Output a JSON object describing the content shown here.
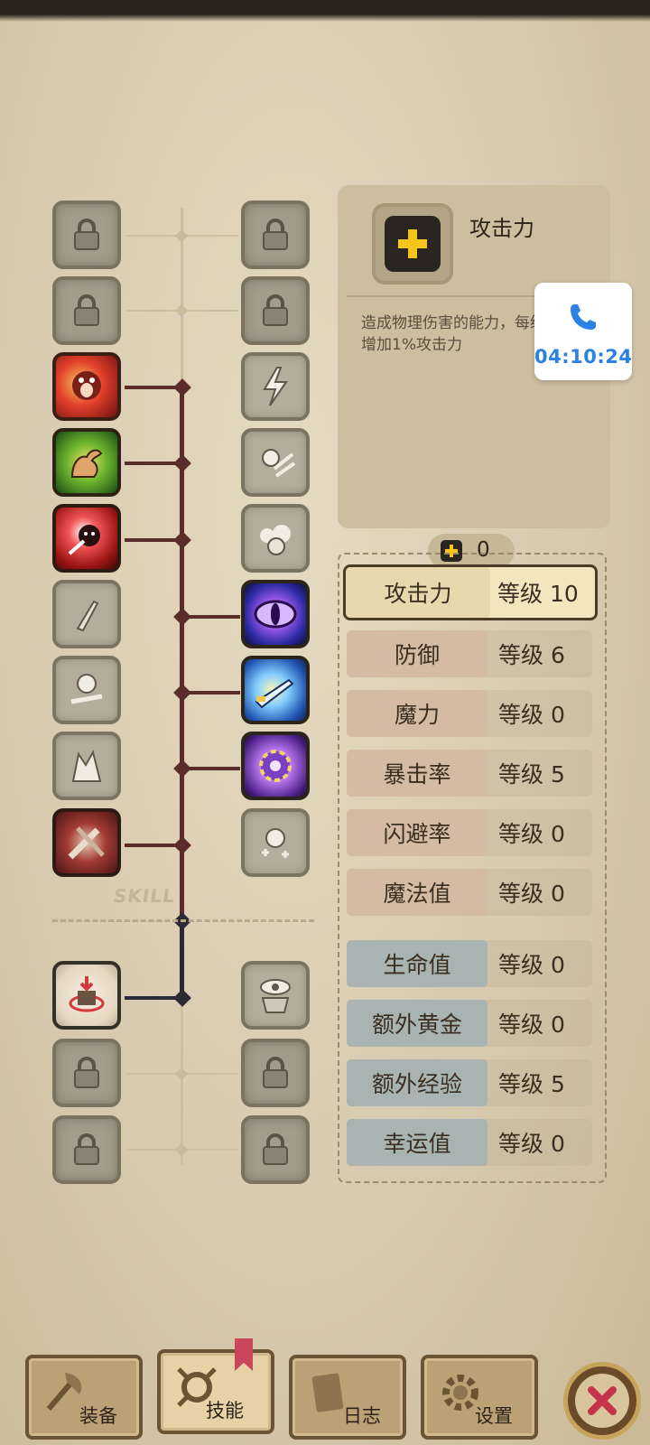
{
  "skill_tree": {
    "section_label": "SKILL",
    "left_column": [
      {
        "name": "locked-skill",
        "state": "locked"
      },
      {
        "name": "locked-skill",
        "state": "locked"
      },
      {
        "name": "roar-skill",
        "state": "unlocked",
        "color": "red"
      },
      {
        "name": "strength-skill",
        "state": "unlocked",
        "color": "green"
      },
      {
        "name": "slash-skill",
        "state": "unlocked",
        "color": "crimson"
      },
      {
        "name": "dagger-skill",
        "state": "inactive"
      },
      {
        "name": "dash-skill",
        "state": "inactive"
      },
      {
        "name": "fury-skill",
        "state": "inactive"
      },
      {
        "name": "blade-skill",
        "state": "unlocked",
        "color": "maroon"
      },
      {
        "name": "defense-skill",
        "state": "unlocked",
        "color": "cream"
      },
      {
        "name": "locked-skill",
        "state": "locked"
      },
      {
        "name": "locked-skill",
        "state": "locked"
      }
    ],
    "right_column": [
      {
        "name": "locked-skill",
        "state": "locked"
      },
      {
        "name": "locked-skill",
        "state": "locked"
      },
      {
        "name": "lightning-skill",
        "state": "inactive"
      },
      {
        "name": "charge-skill",
        "state": "inactive"
      },
      {
        "name": "storm-skill",
        "state": "inactive"
      },
      {
        "name": "eye-skill",
        "state": "unlocked",
        "color": "violet"
      },
      {
        "name": "sword-skill",
        "state": "unlocked",
        "color": "azure"
      },
      {
        "name": "orb-skill",
        "state": "unlocked",
        "color": "orchid"
      },
      {
        "name": "heal-skill",
        "state": "inactive"
      },
      {
        "name": "vision-skill",
        "state": "inactive"
      },
      {
        "name": "locked-skill",
        "state": "locked"
      },
      {
        "name": "locked-skill",
        "state": "locked"
      }
    ]
  },
  "info": {
    "title": "攻击力",
    "description": "造成物理伤害的能力，每级增加1%攻击力",
    "icon": "plus-icon"
  },
  "call_overlay": {
    "icon": "phone-icon",
    "time": "04:10:24",
    "color": "#2a82e4"
  },
  "points": {
    "value": "0"
  },
  "stats": [
    {
      "name": "攻击力",
      "level": "等级 10",
      "group": "atk",
      "active": true
    },
    {
      "name": "防御",
      "level": "等级 6",
      "group": "def"
    },
    {
      "name": "魔力",
      "level": "等级 0",
      "group": "def"
    },
    {
      "name": "暴击率",
      "level": "等级 5",
      "group": "def"
    },
    {
      "name": "闪避率",
      "level": "等级 0",
      "group": "def"
    },
    {
      "name": "魔法值",
      "level": "等级 0",
      "group": "def"
    },
    {
      "name": "生命值",
      "level": "等级 0",
      "group": "util"
    },
    {
      "name": "额外黄金",
      "level": "等级 0",
      "group": "util"
    },
    {
      "name": "额外经验",
      "level": "等级 5",
      "group": "util"
    },
    {
      "name": "幸运值",
      "level": "等级 0",
      "group": "util"
    }
  ],
  "tabs": [
    {
      "label": "装备",
      "icon": "axe-icon"
    },
    {
      "label": "技能",
      "icon": "skill-icon",
      "active": true
    },
    {
      "label": "日志",
      "icon": "journal-icon"
    },
    {
      "label": "设置",
      "icon": "gear-icon"
    }
  ],
  "close_button": {
    "icon": "close-icon",
    "color": "#c4344a"
  }
}
